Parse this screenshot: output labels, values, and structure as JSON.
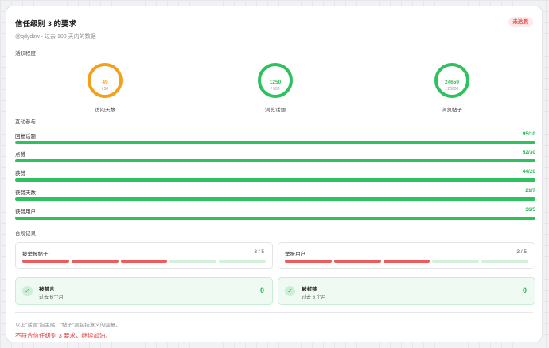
{
  "header": {
    "title": "信任级别 3 的要求",
    "subtitle": "@qdydzw - 过去 100 天内的数据",
    "status_badge": "未达到"
  },
  "activity": {
    "label": "活跃程度",
    "circles": [
      {
        "value": "49",
        "target": "/ 50",
        "label": "访问天数",
        "fraction": 0.98,
        "color": "#f5a01d"
      },
      {
        "value": "1250",
        "target": "/ 500",
        "label": "浏览话题",
        "fraction": 1.0,
        "color": "#2ec15f"
      },
      {
        "value": "24659",
        "target": "/ 20000",
        "label": "浏览帖子",
        "fraction": 1.0,
        "color": "#2ec15f"
      }
    ]
  },
  "interaction": {
    "label": "互动参与",
    "bars": [
      {
        "label": "回复话题",
        "value": "95/10",
        "fraction": 1.0
      },
      {
        "label": "点赞",
        "value": "52/30",
        "fraction": 1.0
      },
      {
        "label": "获赞",
        "value": "44/20",
        "fraction": 1.0
      },
      {
        "label": "获赞天数",
        "value": "21/7",
        "fraction": 1.0
      },
      {
        "label": "获赞用户",
        "value": "36/5",
        "fraction": 1.0
      }
    ]
  },
  "compliance": {
    "label": "合规记录",
    "reports": [
      {
        "label": "被举报帖子",
        "count": "3 / 5",
        "filled": 3,
        "total": 5
      },
      {
        "label": "举报用户",
        "count": "3 / 5",
        "filled": 3,
        "total": 5
      }
    ],
    "bans": [
      {
        "title": "被禁言",
        "subtitle": "过去 6 个月",
        "count": "0"
      },
      {
        "title": "被封禁",
        "subtitle": "过去 6 个月",
        "count": "0"
      }
    ]
  },
  "footer": {
    "note": "以上\"话题\"指主贴，\"帖子\"则包括意义的回复。",
    "verdict": "不符合信任级别 3 要求，继续加油。"
  },
  "colors": {
    "success": "#2ec15f",
    "warning": "#f5a01d",
    "danger": "#ee5b5b",
    "segment_empty": "#d3f0dc"
  }
}
